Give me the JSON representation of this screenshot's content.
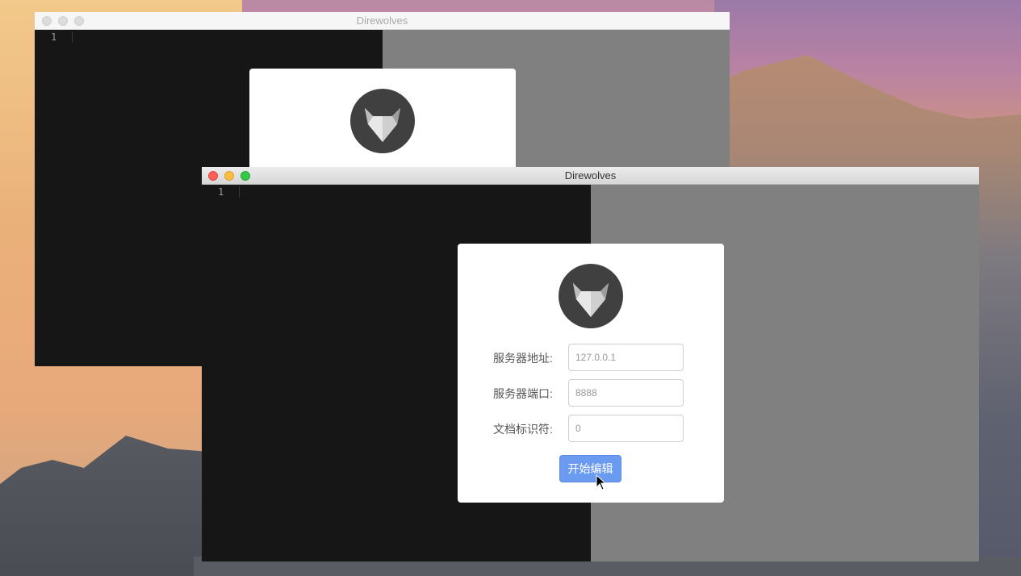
{
  "colors": {
    "editor_bg": "#161616",
    "preview_bg": "#808080",
    "button_bg": "#6a9bf0",
    "logo_bg": "#404040"
  },
  "back_window": {
    "title": "Direwolves",
    "line_number": "1",
    "logo_icon": "fox-logo-icon"
  },
  "front_window": {
    "title": "Direwolves",
    "line_number": "1",
    "dialog": {
      "logo_icon": "fox-logo-icon",
      "fields": [
        {
          "label": "服务器地址:",
          "value": "127.0.0.1"
        },
        {
          "label": "服务器端口:",
          "value": "8888"
        },
        {
          "label": "文档标识符:",
          "value": "0"
        }
      ],
      "submit_label": "开始编辑"
    }
  }
}
